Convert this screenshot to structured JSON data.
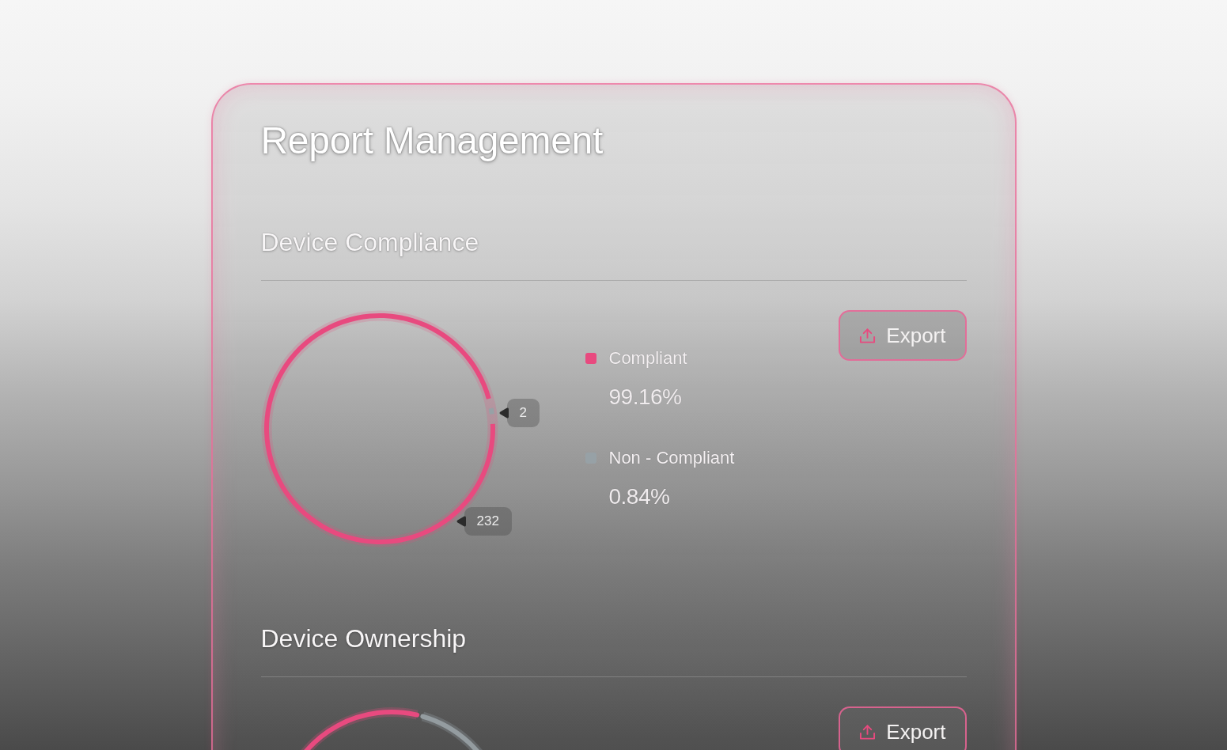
{
  "title": "Report Management",
  "sections": [
    {
      "heading": "Device Compliance",
      "export_button": "Export",
      "chart_data": {
        "type": "donut",
        "categories": [
          "Compliant",
          "Non - Compliant"
        ],
        "values": [
          99.16,
          0.84
        ]
      },
      "device_counts": [
        "232",
        "2"
      ],
      "legend": [
        {
          "value": "99.16%",
          "color": "#e84a7f"
        },
        {
          "value": "0.84%",
          "color": "#97a1a6"
        }
      ]
    },
    {
      "heading": "Device Ownership",
      "export_button": "Export"
    }
  ]
}
